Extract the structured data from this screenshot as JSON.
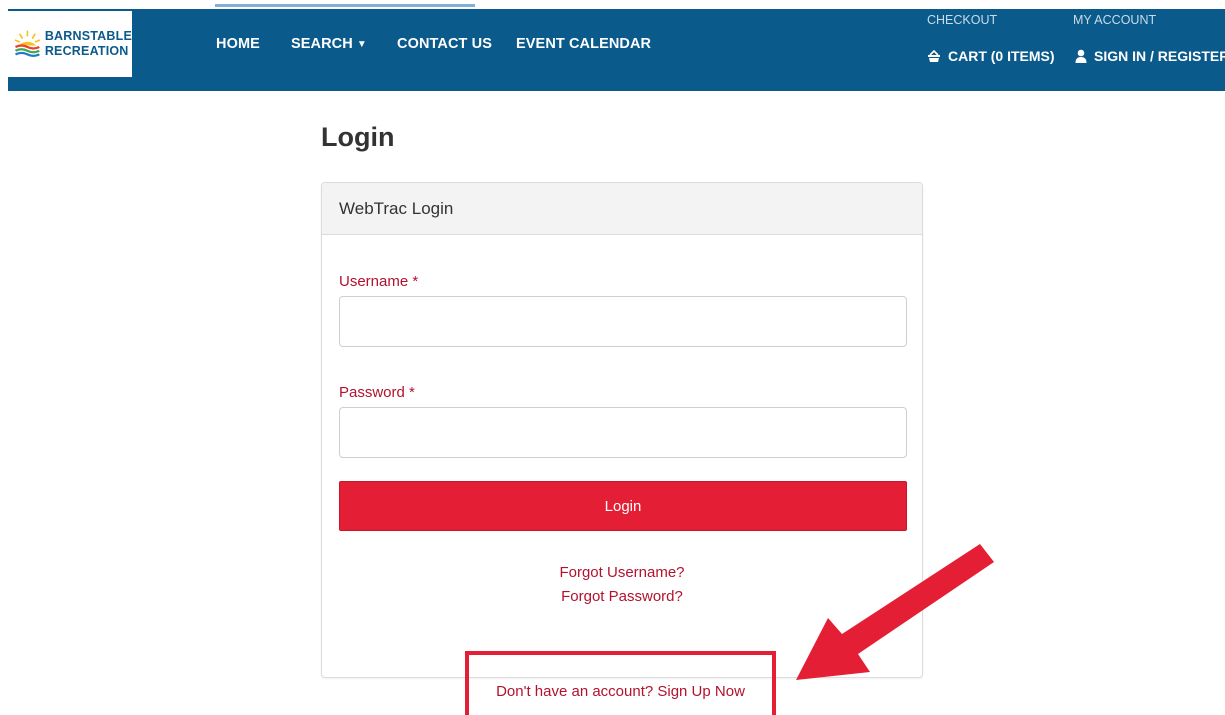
{
  "colors": {
    "navbar": "#0b5a8c",
    "accent_red": "#e41e34",
    "label_red": "#b3122d",
    "panel_heading_bg": "#f3f3f3"
  },
  "logo": {
    "line1": "BARNSTABLE",
    "line2": "RECREATION",
    "icon": "sunrise-waves-logo"
  },
  "nav": {
    "home": "HOME",
    "search": "SEARCH",
    "contact": "CONTACT US",
    "calendar": "EVENT CALENDAR",
    "checkout_label": "CHECKOUT",
    "cart": "CART (0 ITEMS)",
    "account_label": "MY ACCOUNT",
    "signin": "SIGN IN / REGISTER",
    "search_icon": "caret-down-icon",
    "cart_icon": "cart-icon",
    "signin_icon": "user-icon"
  },
  "page": {
    "title": "Login"
  },
  "panel": {
    "heading": "WebTrac Login",
    "username_label": "Username *",
    "username_value": "",
    "password_label": "Password *",
    "password_value": "",
    "login_button": "Login",
    "forgot_username": "Forgot Username?",
    "forgot_password": "Forgot Password?"
  },
  "signup": {
    "text": "Don't have an account? Sign Up Now"
  },
  "annotation": {
    "arrow_icon": "red-arrow-icon"
  }
}
